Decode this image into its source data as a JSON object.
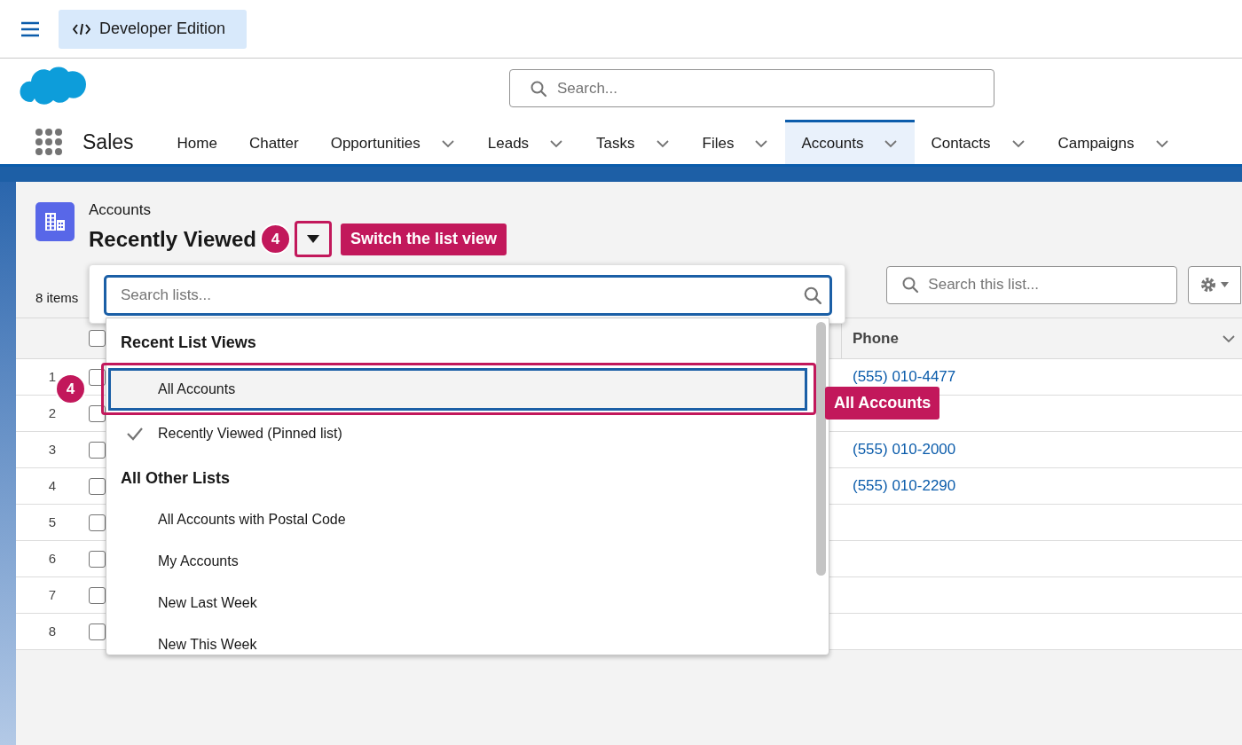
{
  "top_bar": {
    "edition": "Developer Edition"
  },
  "global_search": {
    "placeholder": "Search..."
  },
  "app": {
    "name": "Sales"
  },
  "nav_tabs": [
    {
      "label": "Home",
      "selected": false,
      "has_menu": false
    },
    {
      "label": "Chatter",
      "selected": false,
      "has_menu": false
    },
    {
      "label": "Opportunities",
      "selected": false,
      "has_menu": true
    },
    {
      "label": "Leads",
      "selected": false,
      "has_menu": true
    },
    {
      "label": "Tasks",
      "selected": false,
      "has_menu": true
    },
    {
      "label": "Files",
      "selected": false,
      "has_menu": true
    },
    {
      "label": "Accounts",
      "selected": true,
      "has_menu": true
    },
    {
      "label": "Contacts",
      "selected": false,
      "has_menu": true
    },
    {
      "label": "Campaigns",
      "selected": false,
      "has_menu": true
    }
  ],
  "page": {
    "object": "Accounts",
    "list_view": "Recently Viewed",
    "item_count": "8 items",
    "list_search": {
      "placeholder": "Search this list..."
    }
  },
  "table": {
    "select_all": {
      "checked": false
    },
    "columns": [
      {
        "label": "Phone"
      }
    ],
    "rows": [
      {
        "number": "1",
        "checked": false,
        "phone": "(555) 010-4477"
      },
      {
        "number": "2",
        "checked": false
      },
      {
        "number": "3",
        "checked": false,
        "phone": "(555) 010-2000"
      },
      {
        "number": "4",
        "checked": false,
        "phone": "(555) 010-2290"
      },
      {
        "number": "5",
        "checked": false
      },
      {
        "number": "6",
        "checked": false
      },
      {
        "number": "7",
        "checked": false
      },
      {
        "number": "8",
        "checked": false
      }
    ]
  },
  "list_view_menu": {
    "search": {
      "placeholder": "Search lists..."
    },
    "sections": [
      {
        "title": "Recent List Views",
        "items": [
          {
            "label": "All Accounts",
            "checked": false,
            "selected": true
          },
          {
            "label": "Recently Viewed (Pinned list)",
            "checked": true,
            "selected": false
          }
        ]
      },
      {
        "title": "All Other Lists",
        "items": [
          {
            "label": "All Accounts with Postal Code",
            "checked": false,
            "selected": false
          },
          {
            "label": "My Accounts",
            "checked": false,
            "selected": false
          },
          {
            "label": "New Last Week",
            "checked": false,
            "selected": false
          },
          {
            "label": "New This Week",
            "checked": false,
            "selected": false
          }
        ]
      }
    ]
  },
  "annotations": {
    "dropdown_step": "4",
    "dropdown_callout": "Switch the list view",
    "item_step": "4",
    "item_callout": "All Accounts"
  }
}
